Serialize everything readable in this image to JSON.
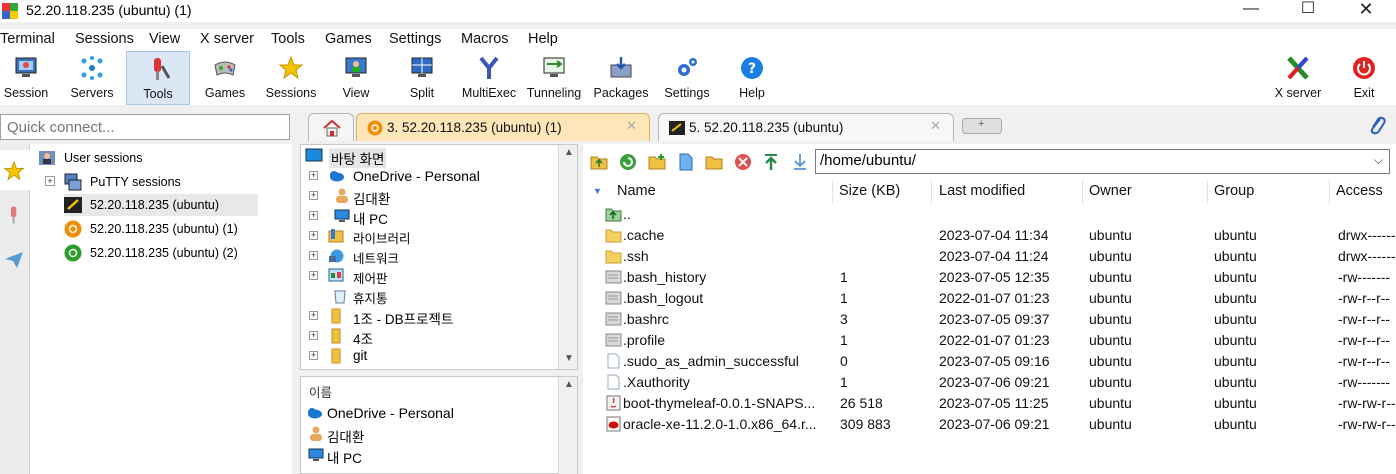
{
  "window": {
    "title": "52.20.118.235 (ubuntu) (1)"
  },
  "menu": [
    "Terminal",
    "Sessions",
    "View",
    "X server",
    "Tools",
    "Games",
    "Settings",
    "Macros",
    "Help"
  ],
  "toolbar": {
    "items": [
      "Session",
      "Servers",
      "Tools",
      "Games",
      "Sessions",
      "View",
      "Split",
      "MultiExec",
      "Tunneling",
      "Packages",
      "Settings",
      "Help"
    ],
    "right": [
      "X server",
      "Exit"
    ]
  },
  "quick_connect": {
    "placeholder": "Quick connect..."
  },
  "tabs": [
    "3. 52.20.118.235 (ubuntu) (1)",
    "5. 52.20.118.235 (ubuntu)"
  ],
  "sessions": {
    "root": "User sessions",
    "putty": "PuTTY sessions",
    "items": [
      "52.20.118.235 (ubuntu)",
      "52.20.118.235 (ubuntu) (1)",
      "52.20.118.235 (ubuntu) (2)"
    ]
  },
  "tree": {
    "root": "바탕 화면",
    "items": [
      "OneDrive - Personal",
      "김대환",
      "내 PC",
      "라이브러리",
      "네트워크",
      "제어판",
      "휴지통",
      "1조 - DB프로젝트",
      "4조",
      "git"
    ]
  },
  "namelist": {
    "header": "이름",
    "items": [
      "OneDrive - Personal",
      "김대환",
      "내 PC"
    ]
  },
  "files": {
    "path": "/home/ubuntu/",
    "columns": [
      "Name",
      "Size (KB)",
      "Last modified",
      "Owner",
      "Group",
      "Access"
    ],
    "rows": [
      {
        "name": "..",
        "size": "",
        "modified": "",
        "owner": "",
        "group": "",
        "access": "",
        "icon": "up-folder"
      },
      {
        "name": ".cache",
        "size": "",
        "modified": "2023-07-04 11:34",
        "owner": "ubuntu",
        "group": "ubuntu",
        "access": "drwx------",
        "icon": "folder"
      },
      {
        "name": ".ssh",
        "size": "",
        "modified": "2023-07-04 11:24",
        "owner": "ubuntu",
        "group": "ubuntu",
        "access": "drwx------",
        "icon": "folder"
      },
      {
        "name": ".bash_history",
        "size": "1",
        "modified": "2023-07-05 12:35",
        "owner": "ubuntu",
        "group": "ubuntu",
        "access": "-rw-------",
        "icon": "text-file"
      },
      {
        "name": ".bash_logout",
        "size": "1",
        "modified": "2022-01-07 01:23",
        "owner": "ubuntu",
        "group": "ubuntu",
        "access": "-rw-r--r--",
        "icon": "text-file"
      },
      {
        "name": ".bashrc",
        "size": "3",
        "modified": "2023-07-05 09:37",
        "owner": "ubuntu",
        "group": "ubuntu",
        "access": "-rw-r--r--",
        "icon": "text-file"
      },
      {
        "name": ".profile",
        "size": "1",
        "modified": "2022-01-07 01:23",
        "owner": "ubuntu",
        "group": "ubuntu",
        "access": "-rw-r--r--",
        "icon": "text-file"
      },
      {
        "name": ".sudo_as_admin_successful",
        "size": "0",
        "modified": "2023-07-05 09:16",
        "owner": "ubuntu",
        "group": "ubuntu",
        "access": "-rw-r--r--",
        "icon": "blank-file"
      },
      {
        "name": ".Xauthority",
        "size": "1",
        "modified": "2023-07-06 09:21",
        "owner": "ubuntu",
        "group": "ubuntu",
        "access": "-rw-------",
        "icon": "blank-file"
      },
      {
        "name": "boot-thymeleaf-0.0.1-SNAPS...",
        "size": "26 518",
        "modified": "2023-07-05 11:25",
        "owner": "ubuntu",
        "group": "ubuntu",
        "access": "-rw-rw-r--",
        "icon": "jar-file"
      },
      {
        "name": "oracle-xe-11.2.0-1.0.x86_64.r...",
        "size": "309 883",
        "modified": "2023-07-06 09:21",
        "owner": "ubuntu",
        "group": "ubuntu",
        "access": "-rw-rw-r--",
        "icon": "rpm-file"
      }
    ]
  }
}
